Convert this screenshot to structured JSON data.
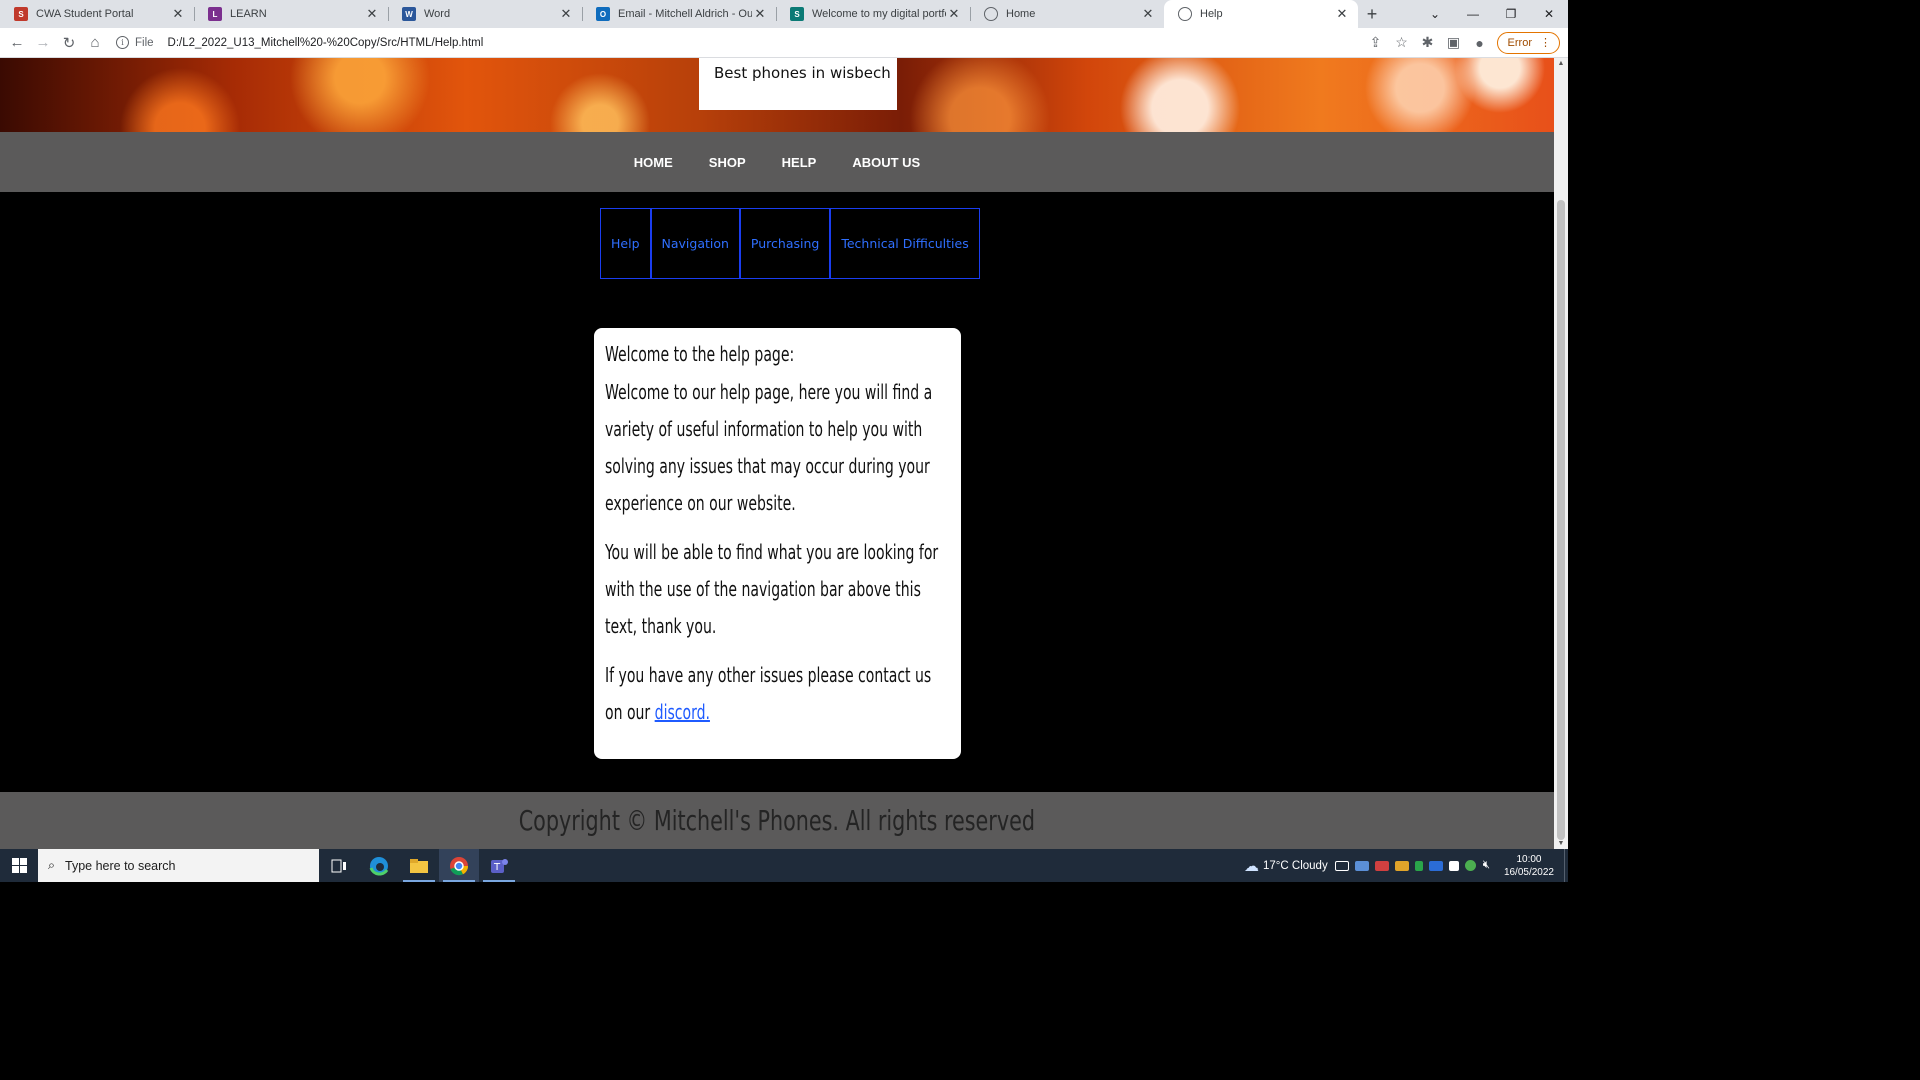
{
  "browser": {
    "tabs": [
      {
        "title": "CWA Student Portal",
        "icon": "cwa-portal-icon",
        "color": "#c0392b"
      },
      {
        "title": "LEARN",
        "icon": "learn-icon",
        "color": "#7b2f8e"
      },
      {
        "title": "Word",
        "icon": "word-icon",
        "color": "#2b579a"
      },
      {
        "title": "Email - Mitchell Aldrich - Outloo",
        "icon": "outlook-icon",
        "color": "#0f6cbd"
      },
      {
        "title": "Welcome to my digital portfolio",
        "icon": "sway-icon",
        "color": "#0b7a75"
      },
      {
        "title": "Home",
        "icon": "globe-icon",
        "color": "#5f6368"
      },
      {
        "title": "Help",
        "icon": "globe-icon",
        "color": "#5f6368"
      }
    ],
    "active_tab": 6,
    "url_scheme": "File",
    "url": "D:/L2_2022_U13_Mitchell%20-%20Copy/Src/HTML/Help.html",
    "profile_status": "Error"
  },
  "page": {
    "hero_label": "Best phones in wisbech",
    "main_nav": [
      "HOME",
      "SHOP",
      "HELP",
      "ABOUT US"
    ],
    "sub_nav": [
      "Help",
      "Navigation",
      "Purchasing",
      "Technical Difficulties"
    ],
    "card": {
      "heading": "Welcome to the help page:",
      "para1": "Welcome to our help page, here you will find a variety of useful information to help you with solving any issues that may occur during your experience on our website.",
      "para2": "You will be able to find what you are looking for with the use of the navigation bar above this text, thank you.",
      "para3_prefix": "If you have any other issues please contact us on our",
      "para3_link": "discord."
    },
    "footer": "Copyright © Mitchell's Phones. All rights reserved"
  },
  "taskbar": {
    "search_placeholder": "Type here to search",
    "weather": "17°C  Cloudy",
    "time": "10:00",
    "date": "16/05/2022"
  }
}
